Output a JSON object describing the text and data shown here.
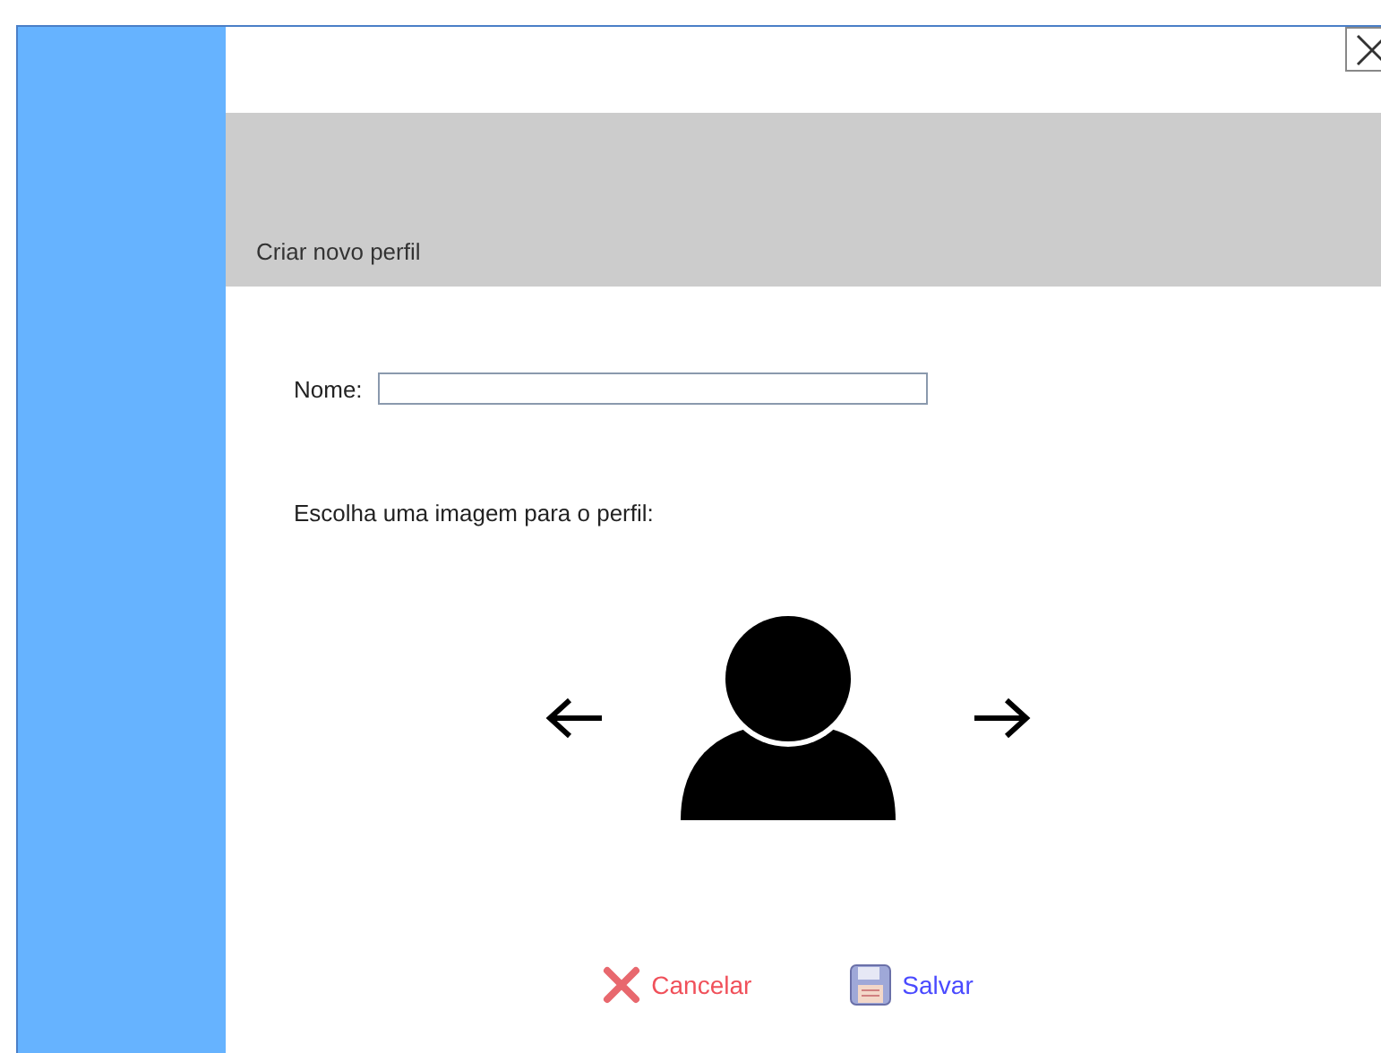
{
  "header": {
    "title": "Criar novo perfil"
  },
  "form": {
    "name_label": "Nome:",
    "image_prompt": "Escolha uma imagem para o perfil:"
  },
  "buttons": [
    {
      "kind": "cancel",
      "label": "Cancelar"
    },
    {
      "kind": "save",
      "label": "Salvar"
    }
  ]
}
